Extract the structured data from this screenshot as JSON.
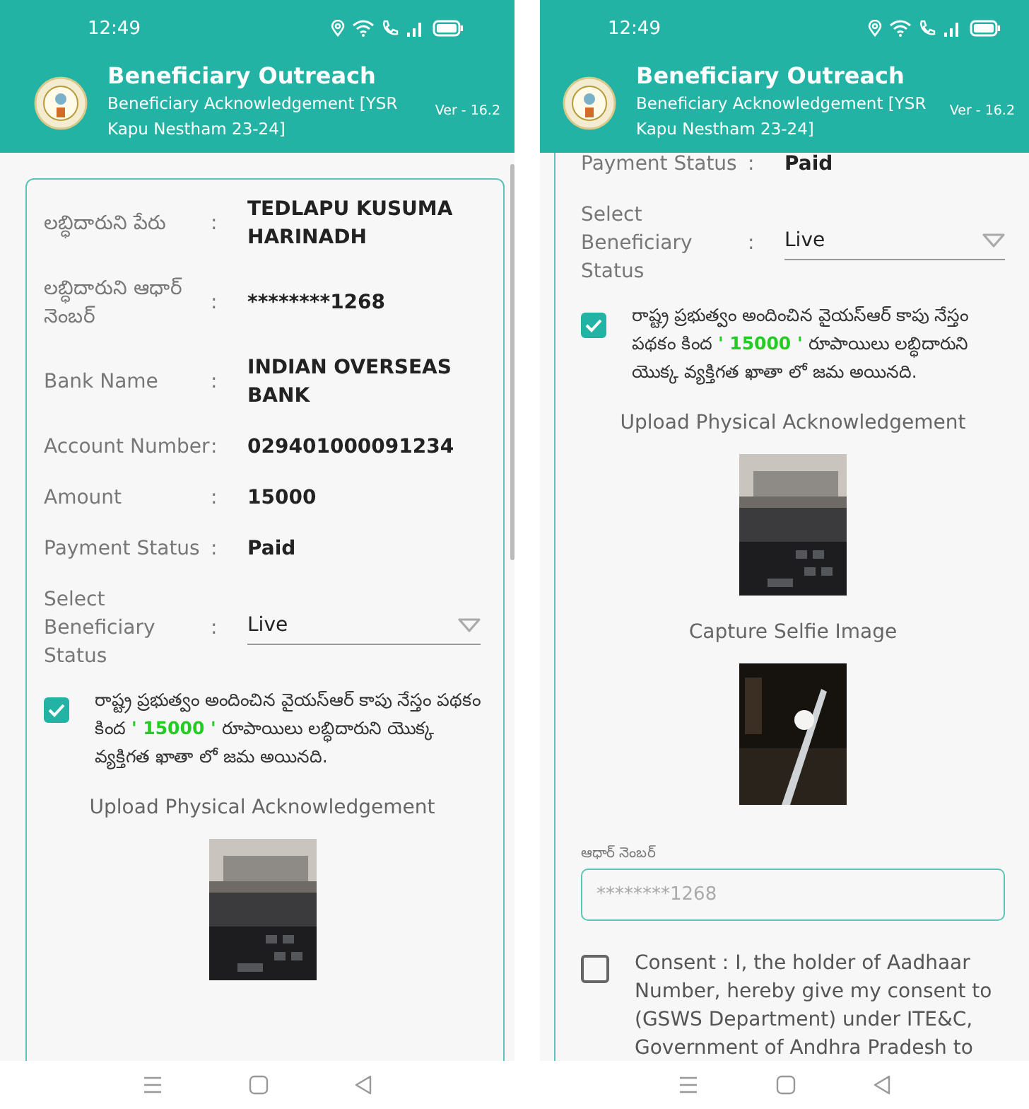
{
  "screens": [
    {
      "status_bar": {
        "time": "12:49"
      },
      "header": {
        "title": "Beneficiary Outreach",
        "subtitle": "Beneficiary Acknowledgement [YSR Kapu Nestham 23-24]",
        "version": "Ver - 16.2"
      },
      "items": [
        {
          "kind": "field",
          "label": "లబ్ధిదారుని పేరు",
          "separator": ":",
          "value": "TEDLAPU KUSUMA HARINADH"
        },
        {
          "kind": "field",
          "label": "లబ్ధిదారుని ఆధార్ నెంబర్",
          "separator": ":",
          "value": "********1268"
        },
        {
          "kind": "field",
          "label": "Bank Name",
          "separator": ":",
          "value": "INDIAN OVERSEAS BANK"
        },
        {
          "kind": "field",
          "label": "Account Number",
          "separator": ":",
          "value": "029401000091234"
        },
        {
          "kind": "field",
          "label": "Amount",
          "separator": ":",
          "value": "15000"
        },
        {
          "kind": "field",
          "label": "Payment Status",
          "separator": ":",
          "value": "Paid"
        },
        {
          "kind": "select",
          "label": "Select Beneficiary Status",
          "separator": ":",
          "value": "Live"
        },
        {
          "kind": "check",
          "checked": true,
          "before": "రాష్ట్ర ప్రభుత్వం  అందించిన వైయస్ఆర్ కాపు నేస్తం పథకం కింద",
          "highlight": "' 15000 '",
          "after": "రూపాయిలు లబ్ధిదారుని యొక్క  వ్యక్తిగత ఖాతా లో జమ అయినది."
        },
        {
          "kind": "heading",
          "text": "Upload Physical Acknowledgement"
        },
        {
          "kind": "picture"
        }
      ]
    },
    {
      "status_bar": {
        "time": "12:49"
      },
      "header": {
        "title": "Beneficiary Outreach",
        "subtitle": "Beneficiary Acknowledgement [YSR Kapu Nestham 23-24]",
        "version": "Ver - 16.2"
      },
      "items": [
        {
          "kind": "field",
          "label": "Payment Status",
          "separator": ":",
          "value": "Paid"
        },
        {
          "kind": "select",
          "label": "Select Beneficiary Status",
          "separator": ":",
          "value": "Live"
        },
        {
          "kind": "check",
          "checked": true,
          "before": "రాష్ట్ర ప్రభుత్వం  అందించిన వైయస్ఆర్ కాపు నేస్తం పథకం కింద",
          "highlight": "' 15000 '",
          "after": "రూపాయిలు లబ్ధిదారుని యొక్క  వ్యక్తిగత ఖాతా లో జమ అయినది."
        },
        {
          "kind": "heading",
          "text": "Upload Physical Acknowledgement"
        },
        {
          "kind": "picture"
        },
        {
          "kind": "heading",
          "text": "Capture Selfie Image"
        },
        {
          "kind": "picture"
        },
        {
          "kind": "input",
          "label": "ఆధార్ నెంబర్",
          "placeholder": "********1268"
        },
        {
          "kind": "consent",
          "checked": false,
          "text": "Consent : I, the holder of Aadhaar Number, hereby give my consent to (GSWS Department) under ITE&C, Government of Andhra Pradesh to"
        }
      ]
    }
  ]
}
